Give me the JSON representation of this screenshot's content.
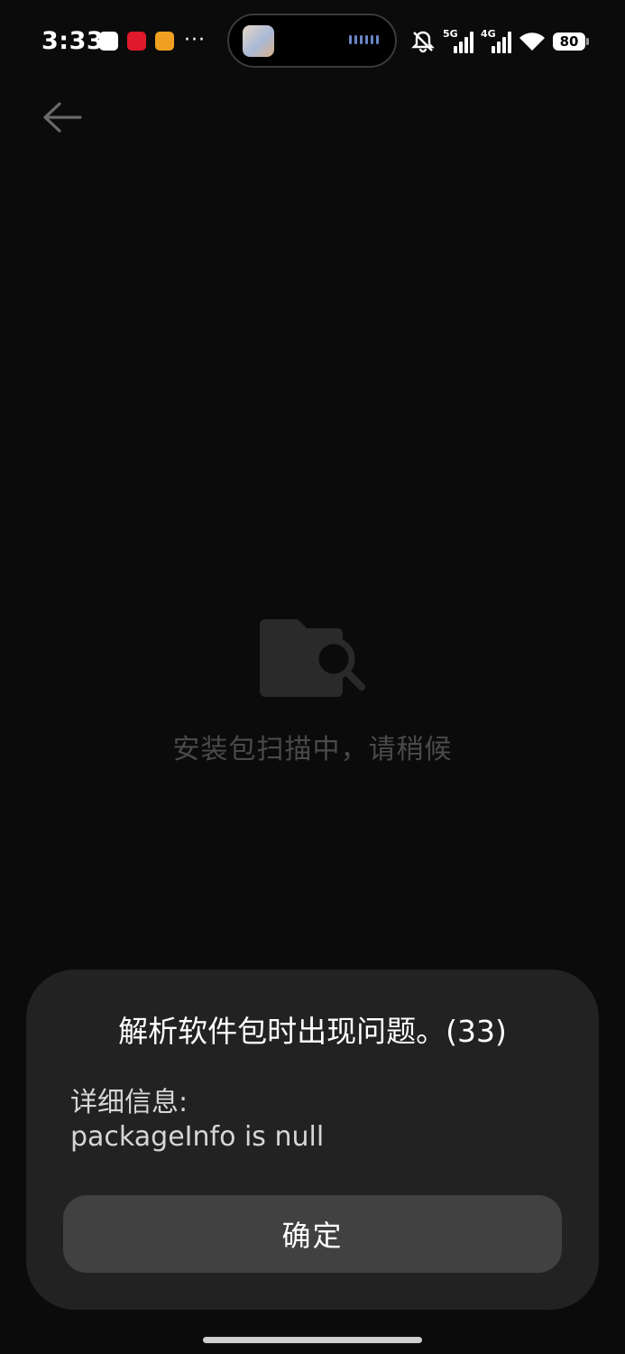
{
  "status_bar": {
    "time": "3:33",
    "notifications": [
      "qq-icon",
      "xiaohongshu-icon",
      "mail-icon"
    ],
    "more": "···",
    "network_1": "5G",
    "network_2": "4G",
    "battery": "80",
    "icons": [
      "mute-icon",
      "signal-icon",
      "wifi-icon",
      "battery-icon"
    ]
  },
  "nav": {
    "back_icon": "back-arrow-icon"
  },
  "scan": {
    "icon": "folder-search-icon",
    "message": "安装包扫描中，请稍候"
  },
  "dialog": {
    "title": "解析软件包时出现问题。(33)",
    "detail_label": "详细信息:",
    "detail_value": "packageInfo is null",
    "confirm_label": "确定"
  },
  "colors": {
    "background": "#0b0b0b",
    "dialog_bg": "#222222",
    "button_bg": "#414141",
    "muted_text": "#4a4a4a"
  }
}
